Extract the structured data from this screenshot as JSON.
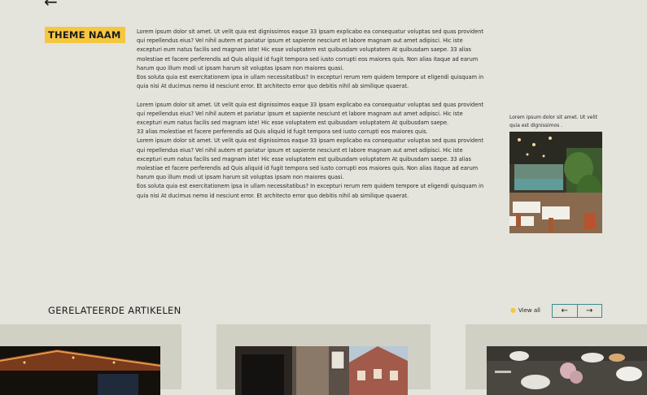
{
  "nav": {
    "back_icon": "arrow-left-icon",
    "back_glyph": "←"
  },
  "theme": {
    "label": "THEME NAAM",
    "color": "#f5c73f"
  },
  "article": {
    "paragraphs": [
      "Lorem ipsum dolor sit amet. Ut velit quia est dignissimos eaque 33 ipsam explicabo ea consequatur voluptas sed quas provident qui repellendus eius? Vel nihil autem et pariatur ipsum et sapiente nesciunt et labore magnam aut amet adipisci. Hic iste excepturi eum natus facilis sed magnam iste! Hic esse voluptatem est quibusdam voluptatem At quibusdam saepe. 33 alias molestiae et facere perferendis ad Quis aliquid id fugit tempora sed iusto corrupti eos maiores quis. Non alias itaque ad earum harum quo illum modi ut ipsam harum sit voluptas ipsam non maiores quasi.",
      "Eos soluta quia est exercitationem ipsa in ullam necessitatibus? In excepturi rerum rem quidem tempore ut eligendi quisquam in quia nisi At ducimus nemo id nesciunt error. Et architecto error quo debitis nihil ab similique quaerat.",
      "Lorem ipsum dolor sit amet. Ut velit quia est dignissimos eaque 33 ipsam explicabo ea consequatur voluptas sed quas provident qui repellendus eius? Vel nihil autem et pariatur ipsum et sapiente nesciunt et labore magnam aut amet adipisci. Hic iste excepturi eum natus facilis sed magnam iste! Hic esse voluptatem est quibusdam voluptatem At quibusdam saepe.",
      "33 alias molestiae et facere perferendis ad Quis aliquid id fugit tempora sed iusto corrupti eos maiores quis.",
      "Lorem ipsum dolor sit amet. Ut velit quia est dignissimos eaque 33 ipsam explicabo ea consequatur voluptas sed quas provident qui repellendus eius? Vel nihil autem et pariatur ipsum et sapiente nesciunt et labore magnam aut amet adipisci. Hic iste excepturi eum natus facilis sed magnam iste! Hic esse voluptatem est quibusdam voluptatem At quibusdam saepe. 33 alias molestiae et facere perferendis ad Quis aliquid id fugit tempora sed iusto corrupti eos maiores quis. Non alias itaque ad earum harum quo illum modi ut ipsam harum sit voluptas ipsam non maiores quasi.",
      "Eos soluta quia est exercitationem ipsa in ullam necessitatibus? In excepturi rerum rem quidem tempore ut eligendi quisquam in quia nisi At ducimus nemo id nesciunt error. Et architecto error quo debitis nihil ab similique quaerat."
    ]
  },
  "sidebar": {
    "caption": "Lorem ipsum dolor sit amet. Ut velit quia est dignissimos ."
  },
  "related": {
    "title": "GERELATEERDE ARTIKELEN",
    "view_all": "View all",
    "prev_glyph": "←",
    "next_glyph": "→",
    "accent": "#3c8d8e"
  }
}
